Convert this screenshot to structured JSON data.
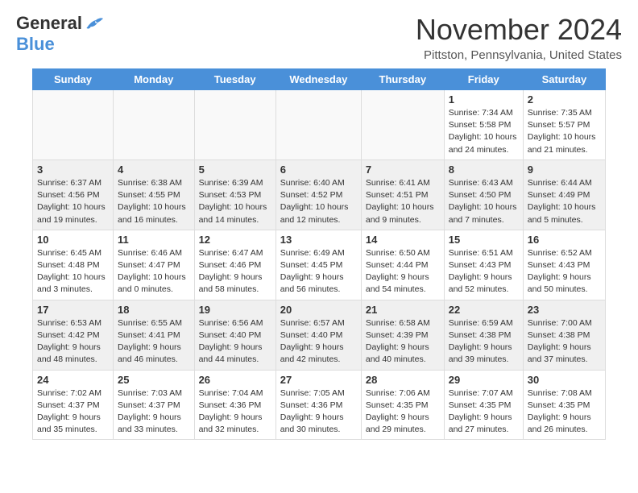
{
  "header": {
    "logo_general": "General",
    "logo_blue": "Blue",
    "month_title": "November 2024",
    "location": "Pittston, Pennsylvania, United States"
  },
  "days": [
    "Sunday",
    "Monday",
    "Tuesday",
    "Wednesday",
    "Thursday",
    "Friday",
    "Saturday"
  ],
  "rows": [
    [
      {
        "day": "",
        "info": ""
      },
      {
        "day": "",
        "info": ""
      },
      {
        "day": "",
        "info": ""
      },
      {
        "day": "",
        "info": ""
      },
      {
        "day": "",
        "info": ""
      },
      {
        "day": "1",
        "info": "Sunrise: 7:34 AM\nSunset: 5:58 PM\nDaylight: 10 hours and 24 minutes."
      },
      {
        "day": "2",
        "info": "Sunrise: 7:35 AM\nSunset: 5:57 PM\nDaylight: 10 hours and 21 minutes."
      }
    ],
    [
      {
        "day": "3",
        "info": "Sunrise: 6:37 AM\nSunset: 4:56 PM\nDaylight: 10 hours and 19 minutes."
      },
      {
        "day": "4",
        "info": "Sunrise: 6:38 AM\nSunset: 4:55 PM\nDaylight: 10 hours and 16 minutes."
      },
      {
        "day": "5",
        "info": "Sunrise: 6:39 AM\nSunset: 4:53 PM\nDaylight: 10 hours and 14 minutes."
      },
      {
        "day": "6",
        "info": "Sunrise: 6:40 AM\nSunset: 4:52 PM\nDaylight: 10 hours and 12 minutes."
      },
      {
        "day": "7",
        "info": "Sunrise: 6:41 AM\nSunset: 4:51 PM\nDaylight: 10 hours and 9 minutes."
      },
      {
        "day": "8",
        "info": "Sunrise: 6:43 AM\nSunset: 4:50 PM\nDaylight: 10 hours and 7 minutes."
      },
      {
        "day": "9",
        "info": "Sunrise: 6:44 AM\nSunset: 4:49 PM\nDaylight: 10 hours and 5 minutes."
      }
    ],
    [
      {
        "day": "10",
        "info": "Sunrise: 6:45 AM\nSunset: 4:48 PM\nDaylight: 10 hours and 3 minutes."
      },
      {
        "day": "11",
        "info": "Sunrise: 6:46 AM\nSunset: 4:47 PM\nDaylight: 10 hours and 0 minutes."
      },
      {
        "day": "12",
        "info": "Sunrise: 6:47 AM\nSunset: 4:46 PM\nDaylight: 9 hours and 58 minutes."
      },
      {
        "day": "13",
        "info": "Sunrise: 6:49 AM\nSunset: 4:45 PM\nDaylight: 9 hours and 56 minutes."
      },
      {
        "day": "14",
        "info": "Sunrise: 6:50 AM\nSunset: 4:44 PM\nDaylight: 9 hours and 54 minutes."
      },
      {
        "day": "15",
        "info": "Sunrise: 6:51 AM\nSunset: 4:43 PM\nDaylight: 9 hours and 52 minutes."
      },
      {
        "day": "16",
        "info": "Sunrise: 6:52 AM\nSunset: 4:43 PM\nDaylight: 9 hours and 50 minutes."
      }
    ],
    [
      {
        "day": "17",
        "info": "Sunrise: 6:53 AM\nSunset: 4:42 PM\nDaylight: 9 hours and 48 minutes."
      },
      {
        "day": "18",
        "info": "Sunrise: 6:55 AM\nSunset: 4:41 PM\nDaylight: 9 hours and 46 minutes."
      },
      {
        "day": "19",
        "info": "Sunrise: 6:56 AM\nSunset: 4:40 PM\nDaylight: 9 hours and 44 minutes."
      },
      {
        "day": "20",
        "info": "Sunrise: 6:57 AM\nSunset: 4:40 PM\nDaylight: 9 hours and 42 minutes."
      },
      {
        "day": "21",
        "info": "Sunrise: 6:58 AM\nSunset: 4:39 PM\nDaylight: 9 hours and 40 minutes."
      },
      {
        "day": "22",
        "info": "Sunrise: 6:59 AM\nSunset: 4:38 PM\nDaylight: 9 hours and 39 minutes."
      },
      {
        "day": "23",
        "info": "Sunrise: 7:00 AM\nSunset: 4:38 PM\nDaylight: 9 hours and 37 minutes."
      }
    ],
    [
      {
        "day": "24",
        "info": "Sunrise: 7:02 AM\nSunset: 4:37 PM\nDaylight: 9 hours and 35 minutes."
      },
      {
        "day": "25",
        "info": "Sunrise: 7:03 AM\nSunset: 4:37 PM\nDaylight: 9 hours and 33 minutes."
      },
      {
        "day": "26",
        "info": "Sunrise: 7:04 AM\nSunset: 4:36 PM\nDaylight: 9 hours and 32 minutes."
      },
      {
        "day": "27",
        "info": "Sunrise: 7:05 AM\nSunset: 4:36 PM\nDaylight: 9 hours and 30 minutes."
      },
      {
        "day": "28",
        "info": "Sunrise: 7:06 AM\nSunset: 4:35 PM\nDaylight: 9 hours and 29 minutes."
      },
      {
        "day": "29",
        "info": "Sunrise: 7:07 AM\nSunset: 4:35 PM\nDaylight: 9 hours and 27 minutes."
      },
      {
        "day": "30",
        "info": "Sunrise: 7:08 AM\nSunset: 4:35 PM\nDaylight: 9 hours and 26 minutes."
      }
    ]
  ]
}
